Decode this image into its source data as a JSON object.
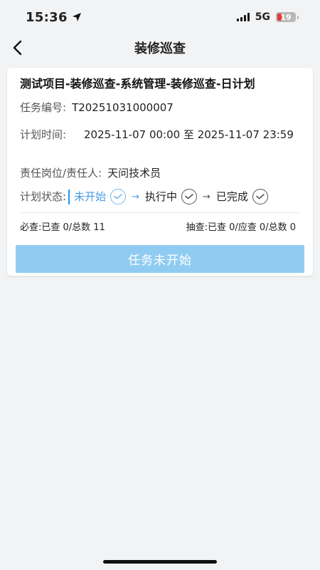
{
  "status_bar": {
    "time": "15:36",
    "network": "5G",
    "battery": "19"
  },
  "nav": {
    "title": "装修巡查"
  },
  "task": {
    "title": "测试项目-装修巡查-系统管理-装修巡查-日计划",
    "number_label": "任务编号:",
    "number": "T20251031000007",
    "time_label": "计划时间:",
    "time_value": "2025-11-07 00:00 至 2025-11-07 23:59",
    "responsible_label": "责任岗位/责任人:",
    "responsible": "天问技术员",
    "status_label": "计划状态:",
    "status_steps": [
      "未开始",
      "执行中",
      "已完成"
    ],
    "required_check": "必查:已查 0/总数 11",
    "spot_check": "抽查:已查 0/应查 0/总数 0",
    "action_button": "任务未开始"
  },
  "colors": {
    "accent": "#4a9be6",
    "button_disabled": "#90ccf2",
    "battery_low": "#e53935"
  }
}
